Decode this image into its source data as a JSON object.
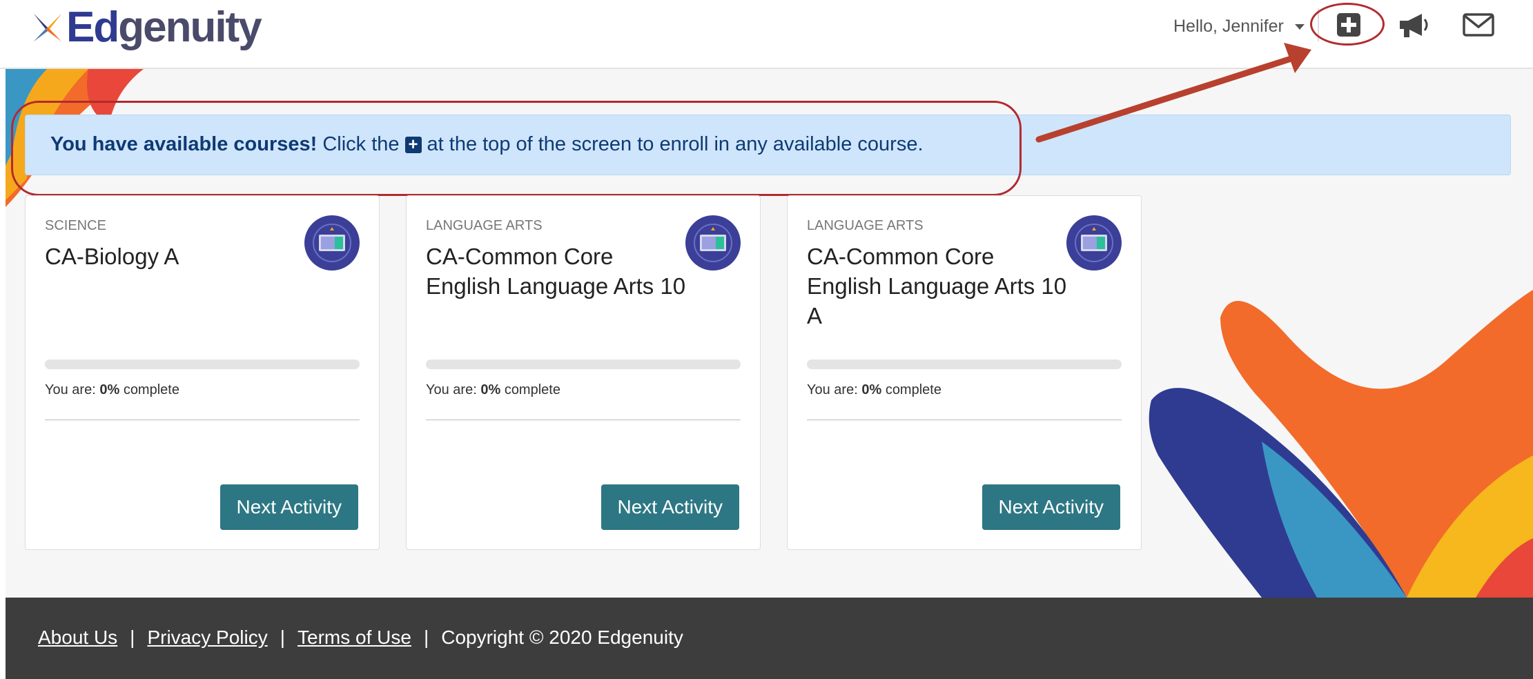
{
  "header": {
    "logo_text_1": "Ed",
    "logo_text_2": "genuity",
    "greeting": "Hello, Jennifer",
    "icons": [
      "plus-square-icon",
      "megaphone-icon",
      "envelope-icon"
    ]
  },
  "alert": {
    "bold": "You have available courses!",
    "before": "Click the",
    "after": "at the top of the screen to enroll in any available course."
  },
  "courses": [
    {
      "subject": "SCIENCE",
      "title": "CA-Biology A",
      "progress_label": "You are:",
      "progress": "0%",
      "complete_label": "complete",
      "button": "Next Activity"
    },
    {
      "subject": "LANGUAGE ARTS",
      "title": "CA-Common Core English Language Arts 10",
      "progress_label": "You are:",
      "progress": "0%",
      "complete_label": "complete",
      "button": "Next Activity"
    },
    {
      "subject": "LANGUAGE ARTS",
      "title": "CA-Common Core English Language Arts 10 A",
      "progress_label": "You are:",
      "progress": "0%",
      "complete_label": "complete",
      "button": "Next Activity"
    }
  ],
  "footer": {
    "about": "About Us",
    "privacy": "Privacy Policy",
    "terms": "Terms of Use",
    "copyright": "Copyright © 2020 Edgenuity",
    "separator": "|"
  },
  "colors": {
    "brand_navy": "#2f3b91",
    "teal_button": "#2d7784",
    "alert_bg": "#cfe5fb",
    "alert_text": "#0e3a74",
    "annotation_red": "#b22a2e",
    "footer_bg": "#3d3d3d"
  }
}
